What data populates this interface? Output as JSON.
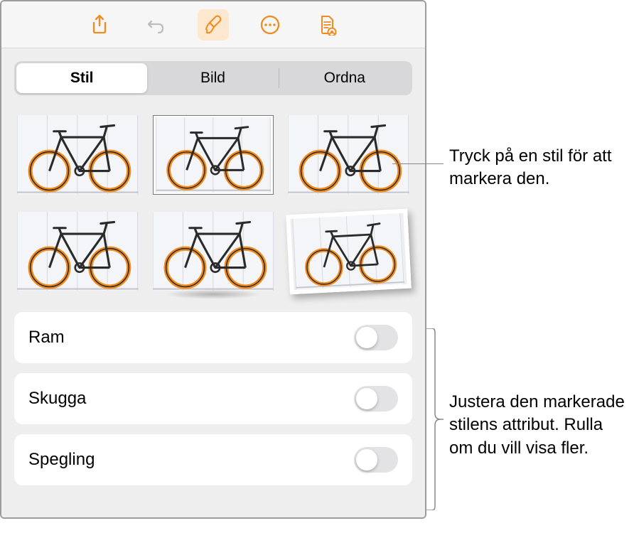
{
  "toolbar": {
    "icons": [
      "share-icon",
      "undo-icon",
      "brush-icon",
      "more-icon",
      "document-icon"
    ]
  },
  "tabs": {
    "items": [
      "Stil",
      "Bild",
      "Ordna"
    ],
    "selected": 0
  },
  "settings": [
    {
      "label": "Ram",
      "enabled": false
    },
    {
      "label": "Skugga",
      "enabled": false
    },
    {
      "label": "Spegling",
      "enabled": false
    }
  ],
  "callouts": {
    "style_hint": "Tryck på en stil för att markera den.",
    "attr_hint": "Justera den markerade stilens attribut. Rulla om du vill visa fler."
  },
  "colors": {
    "accent": "#f28b1e",
    "dim": "#bdbdbd"
  }
}
